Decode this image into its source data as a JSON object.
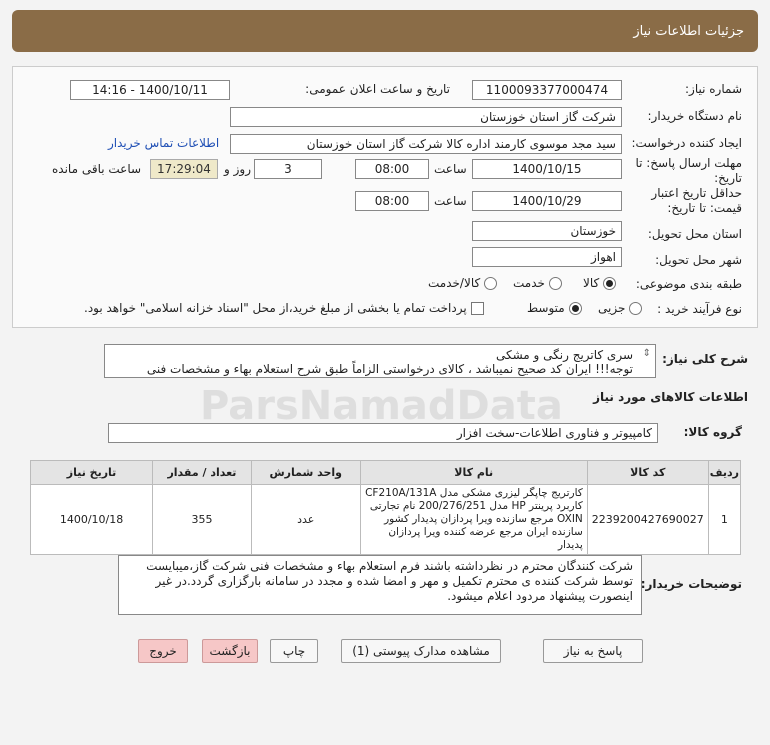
{
  "header": {
    "title": "جزئیات اطلاعات نیاز"
  },
  "form": {
    "need_number_label": "شماره نیاز:",
    "need_number": "1100093377000474",
    "announce_label": "تاریخ و ساعت اعلان عمومی:",
    "announce_value": "1400/10/11 - 14:16",
    "buyer_org_label": "نام دستگاه خریدار:",
    "buyer_org": "شرکت گاز استان خوزستان",
    "creator_label": "ایجاد کننده درخواست:",
    "creator": "سید مجد موسوی کارمند اداره کالا شرکت گاز استان خوزستان",
    "contact_link": "اطلاعات تماس خریدار",
    "deadline_label_1": "مهلت ارسال پاسخ: تا",
    "deadline_label_2": "تاریخ:",
    "deadline_date": "1400/10/15",
    "time_label": "ساعت",
    "deadline_time": "08:00",
    "days_value": "3",
    "days_label": "روز و",
    "remaining_time": "17:29:04",
    "remaining_label": "ساعت باقی مانده",
    "validity_label_1": "حداقل تاریخ اعتبار",
    "validity_label_2": "قیمت: تا تاریخ:",
    "validity_date": "1400/10/29",
    "validity_time_label": "ساعت",
    "validity_time": "08:00",
    "province_label": "استان محل تحویل:",
    "province": "خوزستان",
    "city_label": "شهر محل تحویل:",
    "city": "اهواز",
    "category_label": "طبقه بندی موضوعی:",
    "category_options": [
      "کالا",
      "خدمت",
      "کالا/خدمت"
    ],
    "category_selected": "کالا",
    "process_label": "نوع فرآیند خرید :",
    "process_options": [
      "جزیی",
      "متوسط"
    ],
    "process_selected": "متوسط",
    "payment_note": "پرداخت تمام یا بخشی از مبلغ خرید،از محل \"اسناد خزانه اسلامی\" خواهد بود."
  },
  "summary": {
    "label": "شرح کلی نیاز:",
    "line1": "سری کاتریج رنگی و مشکی",
    "line2": "توجه!!! ایران کد صحیح نمیباشد ، کالای درخواستی الزاماً طبق شرح استعلام بهاء و مشخصات فنی"
  },
  "goods_section_title": "اطلاعات کالاهای مورد نیاز",
  "goods_group_label": "گروه کالا:",
  "goods_group": "کامپیوتر و فناوری اطلاعات-سخت افزار",
  "table": {
    "headers": [
      "ردیف",
      "کد کالا",
      "نام کالا",
      "واحد شمارش",
      "تعداد / مقدار",
      "تاریخ نیاز"
    ],
    "rows": [
      {
        "row": "1",
        "code": "2239200427690027",
        "name": "کارتریج چاپگر لیزری مشکی مدل CF210A/131A کاربرد پرینتر HP مدل 200/276/251 نام تجارتی OXIN مرجع سازنده ویرا پردازان پدیدار کشور سازنده ایران مرجع عرضه کننده ویرا پردازان پدیدار",
        "unit": "عدد",
        "quantity": "355",
        "date": "1400/10/18"
      }
    ]
  },
  "buyer_notes": {
    "label": "توضیحات خریدار:",
    "text": "شرکت کنندگان محترم در نظرداشته باشند فرم استعلام بهاء و مشخصات فنی شرکت گاز،میبایست توسط شرکت کننده ی محترم  تکمیل و مهر و امضا شده و مجدد در سامانه بارگزاری گردد.در غیر اینصورت پیشنهاد مردود اعلام میشود."
  },
  "buttons": {
    "reply": "پاسخ به نیاز",
    "attachments": "مشاهده مدارک پیوستی (1)",
    "print": "چاپ",
    "back": "بازگشت",
    "exit": "خروج"
  },
  "watermark": {
    "text": "ParsNamadData"
  }
}
